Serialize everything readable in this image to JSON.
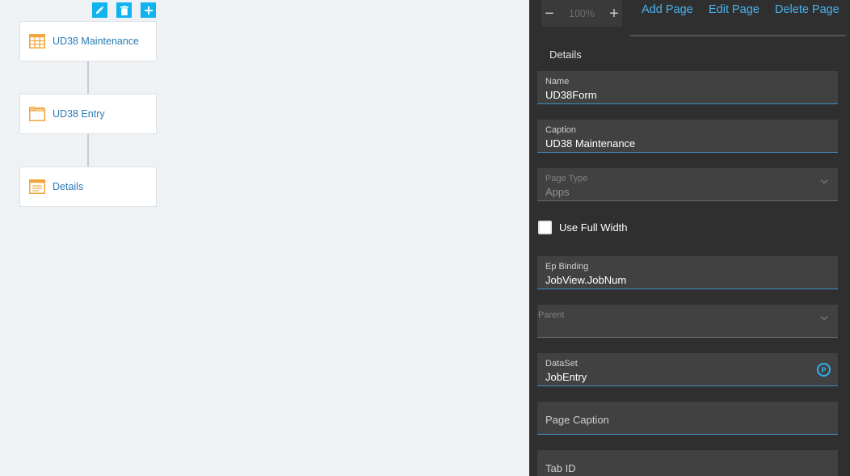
{
  "toolbar": {
    "icons": [
      "edit-icon",
      "trash-icon",
      "plus-icon"
    ]
  },
  "tree": {
    "nodes": [
      {
        "label": "UD38 Maintenance",
        "icon": "grid-icon"
      },
      {
        "label": "UD38 Entry",
        "icon": "window-icon"
      },
      {
        "label": "Details",
        "icon": "form-icon"
      }
    ]
  },
  "header": {
    "zoom_value": "100%",
    "zoom_out": "−",
    "zoom_in": "+",
    "add_page": "Add Page",
    "edit_page": "Edit Page",
    "delete_page": "Delete Page"
  },
  "panel": {
    "title": "Details",
    "name": {
      "label": "Name",
      "value": "UD38Form"
    },
    "caption": {
      "label": "Caption",
      "value": "UD38 Maintenance"
    },
    "page_type": {
      "label": "Page Type",
      "value": "Apps"
    },
    "use_full_width": {
      "label": "Use Full Width",
      "checked": false
    },
    "ep_binding": {
      "label": "Ep Binding",
      "value": "JobView.JobNum"
    },
    "parent": {
      "label": "Parent",
      "value": ""
    },
    "dataset": {
      "label": "DataSet",
      "value": "JobEntry",
      "badge": "P"
    },
    "page_caption": {
      "placeholder": "Page Caption"
    },
    "tab_id": {
      "placeholder": "Tab ID"
    }
  },
  "colors": {
    "accent": "#0fb4ef",
    "link": "#49b3ee",
    "node_text": "#2a7bb4",
    "icon_orange": "#f0a63a",
    "panel_bg": "#2f2f2f",
    "field_bg": "#414141"
  }
}
